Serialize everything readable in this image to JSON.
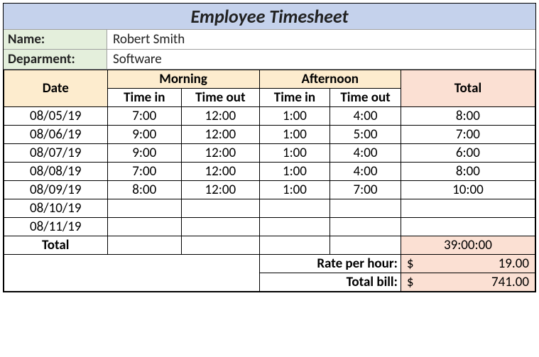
{
  "title": "Employee Timesheet",
  "name_label": "Name:",
  "name_value": "Robert Smith",
  "dept_label": "Deparment:",
  "dept_value": "Software",
  "headers": {
    "date": "Date",
    "morning": "Morning",
    "afternoon": "Afternoon",
    "total": "Total",
    "time_in": "Time in",
    "time_out": "Time out"
  },
  "rows": [
    {
      "date": "08/05/19",
      "m_in": "7:00",
      "m_out": "12:00",
      "a_in": "1:00",
      "a_out": "4:00",
      "total": "8:00"
    },
    {
      "date": "08/06/19",
      "m_in": "9:00",
      "m_out": "12:00",
      "a_in": "1:00",
      "a_out": "5:00",
      "total": "7:00"
    },
    {
      "date": "08/07/19",
      "m_in": "9:00",
      "m_out": "12:00",
      "a_in": "1:00",
      "a_out": "4:00",
      "total": "6:00"
    },
    {
      "date": "08/08/19",
      "m_in": "7:00",
      "m_out": "12:00",
      "a_in": "1:00",
      "a_out": "4:00",
      "total": "8:00"
    },
    {
      "date": "08/09/19",
      "m_in": "8:00",
      "m_out": "12:00",
      "a_in": "1:00",
      "a_out": "7:00",
      "total": "10:00"
    },
    {
      "date": "08/10/19",
      "m_in": "",
      "m_out": "",
      "a_in": "",
      "a_out": "",
      "total": ""
    },
    {
      "date": "08/11/19",
      "m_in": "",
      "m_out": "",
      "a_in": "",
      "a_out": "",
      "total": ""
    }
  ],
  "total_label": "Total",
  "total_hours": "39:00:00",
  "rate_label": "Rate per hour:",
  "rate_value": "19.00",
  "bill_label": "Total bill:",
  "bill_value": "741.00",
  "currency": "$"
}
